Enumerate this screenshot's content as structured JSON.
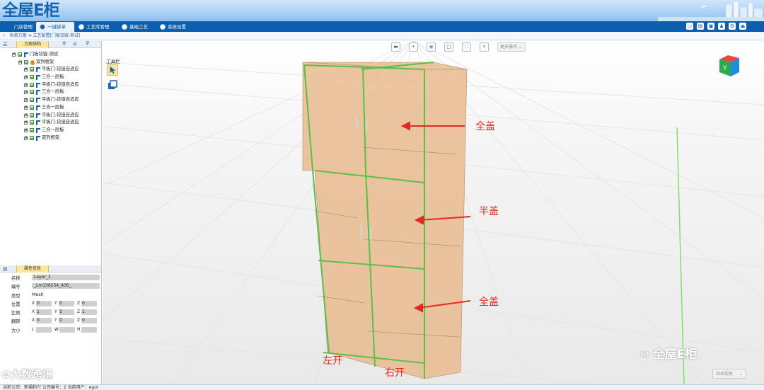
{
  "app": {
    "logo_text": "全屋E柜"
  },
  "nav": {
    "tabs": [
      {
        "label": "门店管理",
        "active": false
      },
      {
        "label": "一键拆单",
        "active": true
      },
      {
        "label": "工艺库管理",
        "active": false
      },
      {
        "label": "基础工艺",
        "active": false
      },
      {
        "label": "系统设置",
        "active": false
      }
    ],
    "right_icons": [
      "window-icon",
      "save-icon",
      "print-icon",
      "user-icon",
      "gear-icon",
      "exit-icon"
    ]
  },
  "breadcrumb": {
    "text": "拆单方案 ➔ 工艺配置[门板铰链-测试]"
  },
  "left_panel": {
    "tree_title": "方案结构",
    "tree": [
      {
        "label": "门板铰链-测试",
        "level": 0,
        "expand": "⊟"
      },
      {
        "label": "双列框架",
        "level": 1,
        "expand": "⊟"
      },
      {
        "label": "平板门-铰链自适应",
        "level": 2,
        "expand": "⊞"
      },
      {
        "label": "三合一层板",
        "level": 2,
        "expand": "⊞"
      },
      {
        "label": "平板门-铰链自适应",
        "level": 2,
        "expand": "⊞"
      },
      {
        "label": "三合一层板",
        "level": 2,
        "expand": "⊞"
      },
      {
        "label": "平板门-铰链自适应",
        "level": 2,
        "expand": "⊞"
      },
      {
        "label": "三合一层板",
        "level": 2,
        "expand": "⊞"
      },
      {
        "label": "平板门-铰链自适应",
        "level": 2,
        "expand": "⊞"
      },
      {
        "label": "平板门-铰链自适应",
        "level": 2,
        "expand": "⊞"
      },
      {
        "label": "三合一层板",
        "level": 2,
        "expand": "⊞"
      },
      {
        "label": "双列框架",
        "level": 2,
        "expand": "⊞"
      }
    ],
    "props_title": "属性信息",
    "props": {
      "name_label": "名称",
      "name_value": "Layer_1",
      "code_label": "编号",
      "code_value": "_Lm136254_A30_",
      "type_label": "类型",
      "type_value": "Mesh",
      "pos_label": "位置",
      "pos": {
        "x": "0",
        "y": "0",
        "z": "0"
      },
      "scale_label": "比例",
      "scale": {
        "x": "1",
        "y": "1",
        "z": "1"
      },
      "rot_label": "翻转",
      "rot": {
        "x": "0",
        "y": "0",
        "z": "0"
      },
      "size_label": "大小",
      "size": {
        "l": "",
        "w": "",
        "h": ""
      }
    }
  },
  "scene": {
    "toolbar_more": "更多操作 ⌄",
    "tool_panel_label": "工具栏",
    "cube_label": "Y",
    "view_select": "自由视角",
    "annotations": {
      "top_full": "全盖",
      "middle_half": "半盖",
      "bottom_full": "全盖",
      "left_open": "左开",
      "right_open": "右开"
    },
    "watermark_right": "全屋E柜",
    "watermark_left": "大数跨境"
  },
  "status_bar": {
    "text": "当前公司：新福和兴   公司编号：2    当前用户：egui"
  },
  "colors": {
    "nav_bg": "#0d5fae",
    "annotation": "#e02a20",
    "cabinet": "#e6b98c",
    "edge": "#5cbf4a"
  }
}
